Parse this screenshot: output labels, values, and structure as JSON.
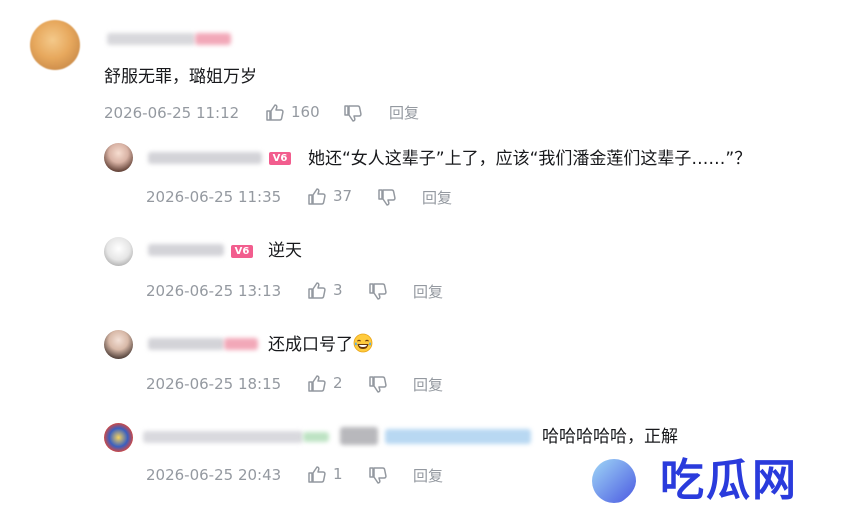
{
  "comments": [
    {
      "text": "舒服无罪，璐姐万岁",
      "time": "2026-06-25 11:12",
      "likes": "160",
      "reply": "回复"
    },
    {
      "text": "她还“女人这辈子”上了，应该“我们潘金莲们这辈子……”？",
      "time": "2026-06-25 11:35",
      "likes": "37",
      "reply": "回复",
      "badge": "V6"
    },
    {
      "text": "逆天",
      "time": "2026-06-25 13:13",
      "likes": "3",
      "reply": "回复",
      "badge": "V6"
    },
    {
      "text": "还成口号了",
      "time": "2026-06-25 18:15",
      "likes": "2",
      "reply": "回复",
      "emoji": "laughing-tears-emoji"
    },
    {
      "text": "哈哈哈哈哈，正解",
      "time": "2026-06-25 20:43",
      "likes": "1",
      "reply": "回复"
    }
  ],
  "watermark": {
    "text": "吃瓜网",
    "color": "#2a3bdc"
  },
  "colors": {
    "meta": "#9499a0",
    "badge": "#f25d8e",
    "text": "#18191c"
  },
  "icons": [
    "thumbs-up-icon",
    "thumbs-down-icon"
  ]
}
